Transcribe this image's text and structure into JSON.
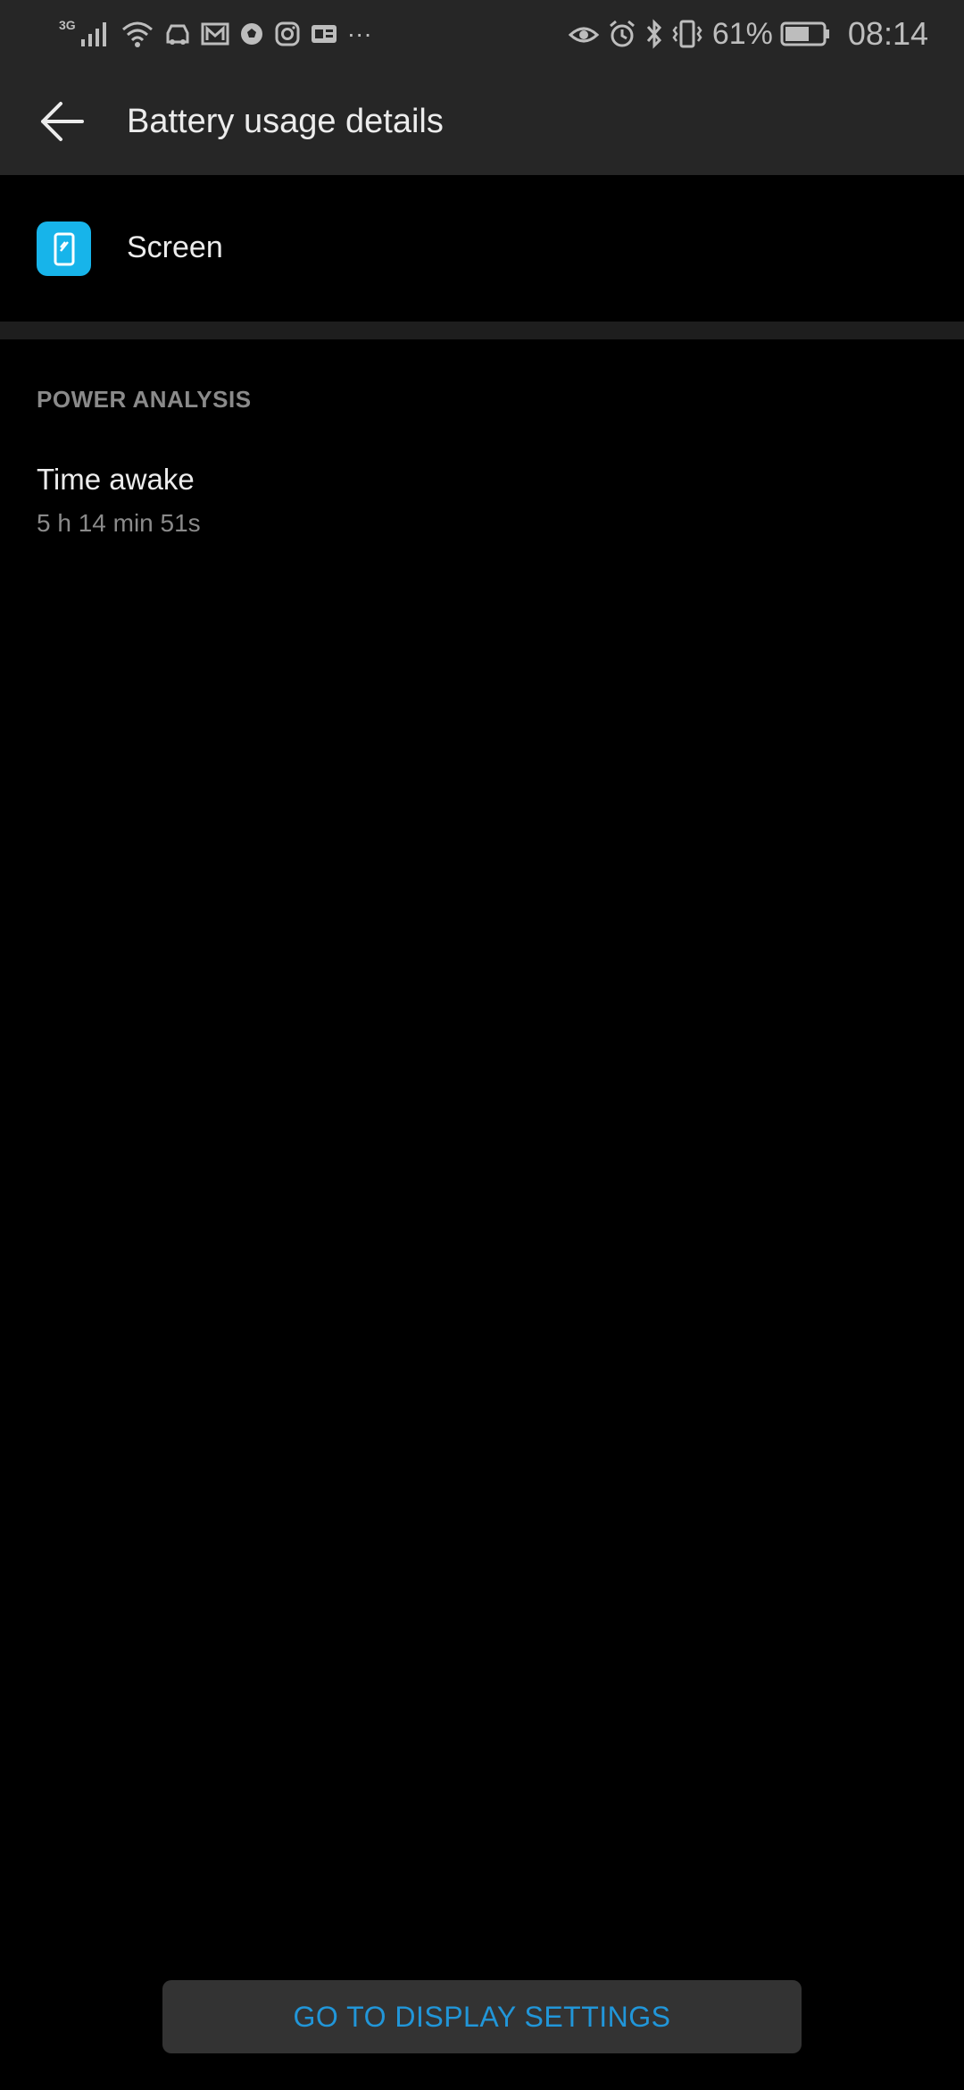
{
  "status_bar": {
    "network_type": "3G",
    "battery_percent": "61%",
    "time": "08:14",
    "overflow": "···",
    "icons_left": [
      "signal-icon",
      "wifi-icon",
      "car-icon",
      "mail-icon",
      "soccer-icon",
      "instagram-icon",
      "news-icon",
      "more-notifications-icon"
    ],
    "icons_right": [
      "eye-icon",
      "alarm-icon",
      "bluetooth-icon",
      "vibrate-icon",
      "battery-icon"
    ]
  },
  "app_bar": {
    "title": "Battery usage details"
  },
  "item": {
    "name": "Screen",
    "icon": "screen-icon",
    "icon_color": "#17b4ea"
  },
  "power_analysis": {
    "header": "POWER ANALYSIS",
    "time_awake_label": "Time awake",
    "time_awake_value": "5 h 14 min 51s"
  },
  "action": {
    "label": "GO TO DISPLAY SETTINGS",
    "color": "#2196d9"
  }
}
